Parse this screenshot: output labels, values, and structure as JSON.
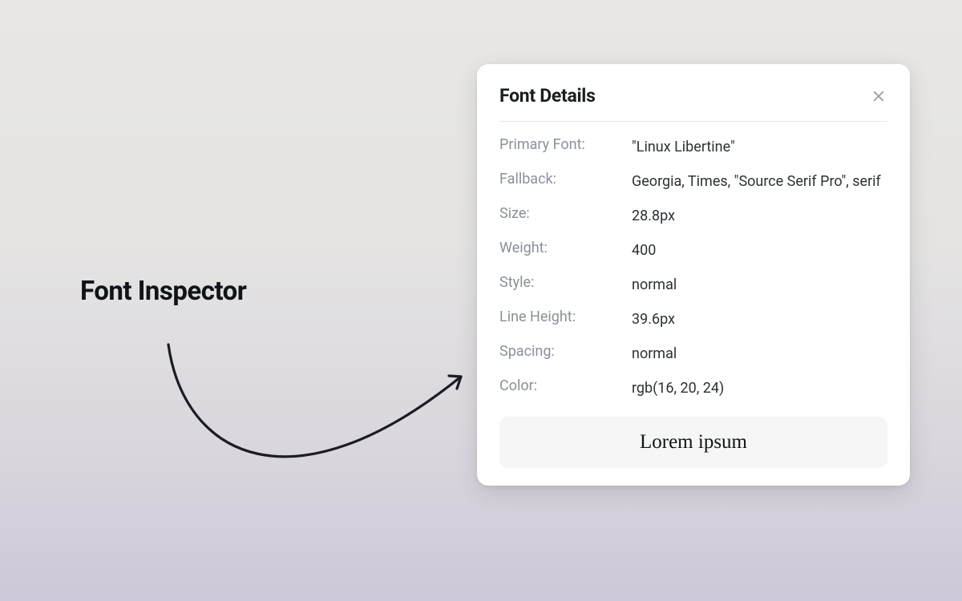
{
  "caption": "Font Inspector",
  "card": {
    "title": "Font Details",
    "rows": [
      {
        "label": "Primary Font:",
        "value": "\"Linux Libertine\""
      },
      {
        "label": "Fallback:",
        "value": "Georgia, Times, \"Source Serif Pro\", serif"
      },
      {
        "label": "Size:",
        "value": "28.8px"
      },
      {
        "label": "Weight:",
        "value": "400"
      },
      {
        "label": "Style:",
        "value": "normal"
      },
      {
        "label": "Line Height:",
        "value": "39.6px"
      },
      {
        "label": "Spacing:",
        "value": "normal"
      },
      {
        "label": "Color:",
        "value": "rgb(16, 20, 24)"
      }
    ],
    "sample": "Lorem ipsum"
  }
}
